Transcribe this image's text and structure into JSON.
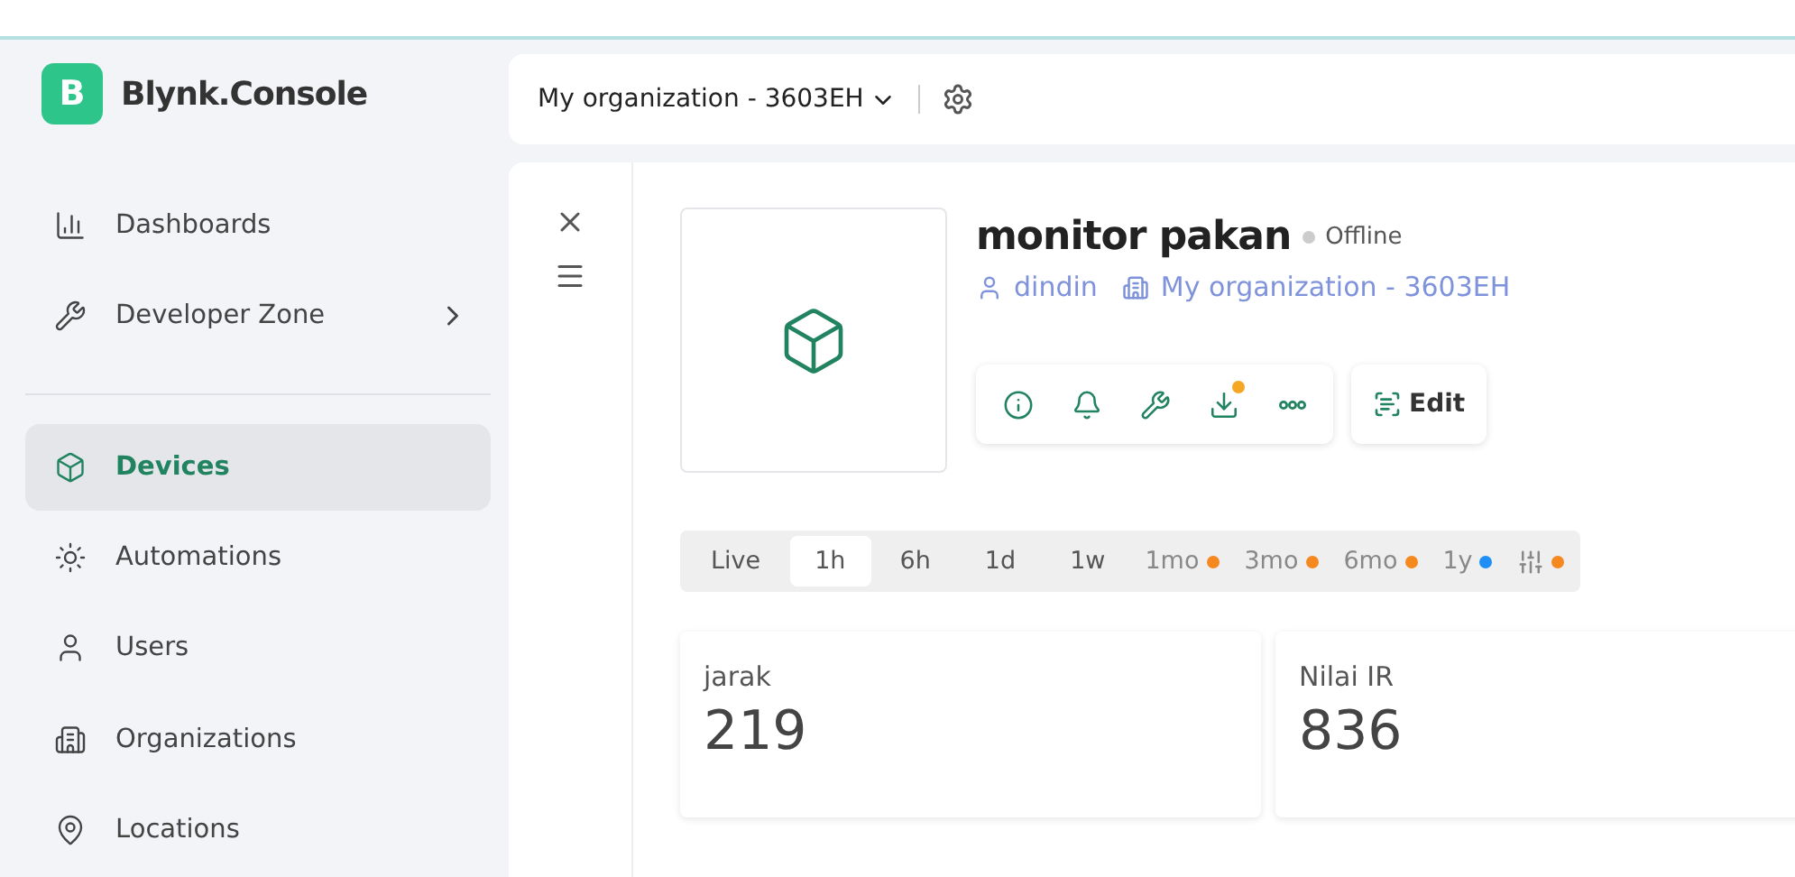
{
  "brand": {
    "logo_letter": "B",
    "name": "Blynk.Console"
  },
  "sidebar": {
    "items": [
      {
        "label": "Dashboards",
        "selected": false,
        "has_submenu": false
      },
      {
        "label": "Developer Zone",
        "selected": false,
        "has_submenu": true
      },
      {
        "kind": "divider"
      },
      {
        "label": "Devices",
        "selected": true,
        "has_submenu": false
      },
      {
        "label": "Automations",
        "selected": false,
        "has_submenu": false
      },
      {
        "label": "Users",
        "selected": false,
        "has_submenu": false
      },
      {
        "label": "Organizations",
        "selected": false,
        "has_submenu": false
      },
      {
        "label": "Locations",
        "selected": false,
        "has_submenu": false
      }
    ]
  },
  "header": {
    "organization": "My organization - 3603EH"
  },
  "device": {
    "name": "monitor pakan",
    "status": "Offline",
    "online": false,
    "owner": "dindin",
    "organization": "My organization - 3603EH",
    "actions": [
      {
        "badge": false
      },
      {
        "badge": false
      },
      {
        "badge": false
      },
      {
        "badge": true
      },
      {
        "badge": false
      }
    ],
    "edit_label": "Edit"
  },
  "time_range": {
    "tabs": [
      {
        "label": "Live",
        "selected": false
      },
      {
        "label": "1h",
        "selected": true
      },
      {
        "label": "6h",
        "selected": false
      },
      {
        "label": "1d",
        "selected": false
      },
      {
        "label": "1w",
        "selected": false
      },
      {
        "label": "1mo",
        "selected": false,
        "color": "#f5891f"
      },
      {
        "label": "3mo",
        "selected": false,
        "color": "#f5891f"
      },
      {
        "label": "6mo",
        "selected": false,
        "color": "#f5891f"
      },
      {
        "label": "1y",
        "selected": false,
        "color": "#1f8ef5"
      }
    ],
    "custom": {
      "color": "#f5891f"
    }
  },
  "widgets": [
    {
      "label": "jarak",
      "value": "219"
    },
    {
      "label": "Nilai IR",
      "value": "836"
    }
  ]
}
